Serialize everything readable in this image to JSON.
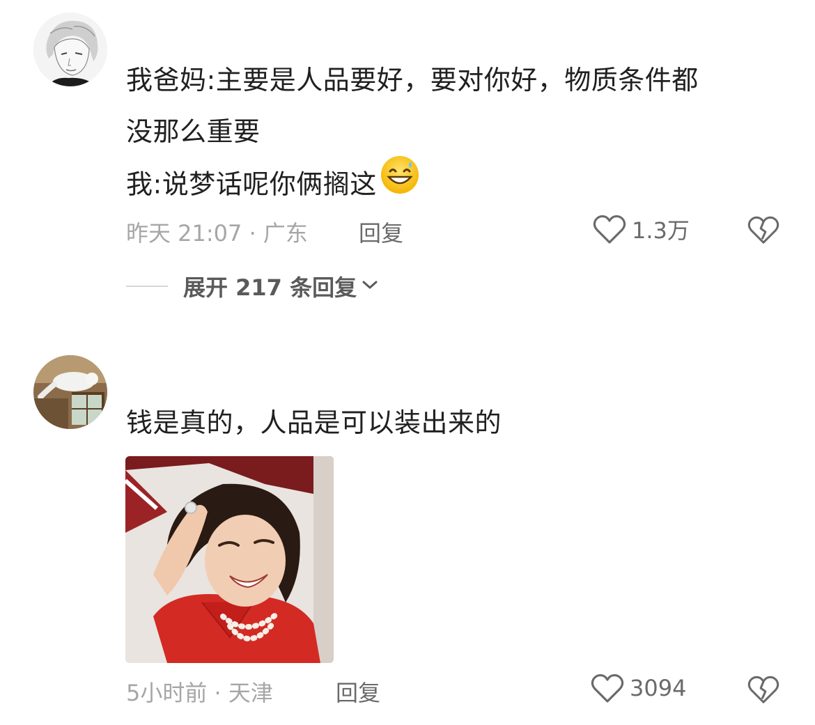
{
  "comments": [
    {
      "avatar": "sketch-man-avatar",
      "lines": [
        "我爸妈:主要是人品要好，要对你好，物质条件都",
        "没那么重要",
        "我:说梦话呢你俩搁这"
      ],
      "emoji": "grinning-sweat-emoji",
      "time": "昨天 21:07",
      "location": "广东",
      "meta": "昨天 21:07 · 广东",
      "reply_label": "回复",
      "likes": "1.3万",
      "expand_label": "展开 217 条回复"
    },
    {
      "avatar": "cat-window-avatar",
      "lines": [
        "钱是真的，人品是可以装出来的"
      ],
      "image": "woman-red-shirt-meme",
      "meta": "5小时前 · 天津",
      "reply_label": "回复",
      "likes": "3094"
    }
  ],
  "icons": {
    "like": "heart-outline-icon",
    "dislike": "broken-heart-icon",
    "expand": "chevron-down-icon"
  },
  "colors": {
    "text": "#202020",
    "meta": "#a6a6a6",
    "action": "#6a6a6a"
  }
}
